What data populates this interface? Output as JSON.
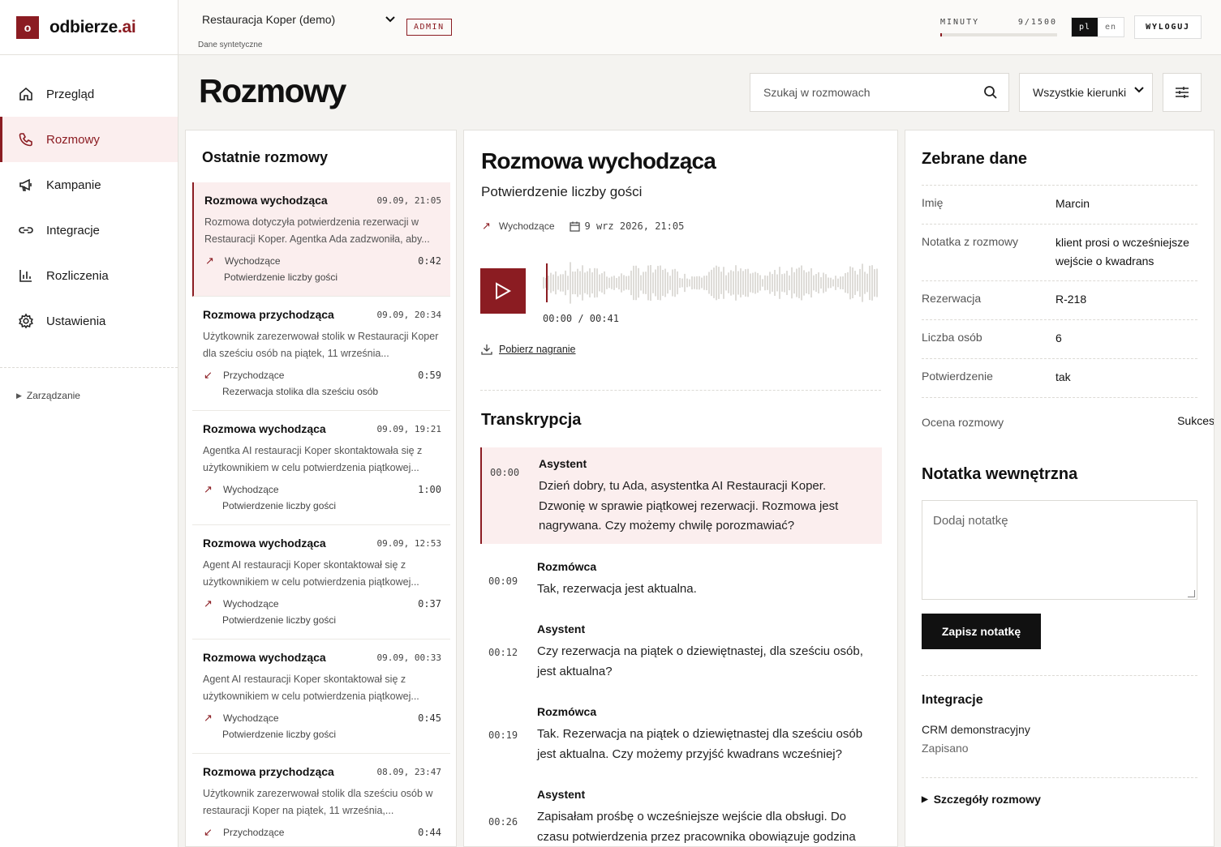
{
  "brand": {
    "logo_letter": "o",
    "name": "odbierze",
    "suffix": ".ai"
  },
  "nav": {
    "items": [
      {
        "label": "Przegląd",
        "icon": "home-icon"
      },
      {
        "label": "Rozmowy",
        "icon": "phone-icon"
      },
      {
        "label": "Kampanie",
        "icon": "megaphone-icon"
      },
      {
        "label": "Integracje",
        "icon": "link-icon"
      },
      {
        "label": "Rozliczenia",
        "icon": "bar-chart-icon"
      },
      {
        "label": "Ustawienia",
        "icon": "gear-icon"
      }
    ],
    "active_index": 1,
    "management_label": "Zarządzanie"
  },
  "topbar": {
    "restaurant": "Restauracja Koper (demo)",
    "restaurant_sub": "Dane syntetyczne",
    "admin_badge": "ADMIN",
    "minutes_label": "MINUTY",
    "minutes_value": "9/1500",
    "minutes_used": 9,
    "minutes_total": 1500,
    "lang_active": "pl",
    "lang_other": "en",
    "logout": "WYLOGUJ"
  },
  "page": {
    "title": "Rozmowy",
    "search_placeholder": "Szukaj w rozmowach",
    "direction_filter": "Wszystkie kierunki"
  },
  "list": {
    "title": "Ostatnie rozmowy",
    "calls": [
      {
        "title": "Rozmowa wychodząca",
        "date": "09.09, 21:05",
        "summary": "Rozmowa dotyczyła potwierdzenia rezerwacji w Restauracji Koper. Agentka Ada zadzwoniła, aby...",
        "direction": "Wychodzące",
        "arrow": "↗",
        "duration": "0:42",
        "topic": "Potwierdzenie liczby gości"
      },
      {
        "title": "Rozmowa przychodząca",
        "date": "09.09, 20:34",
        "summary": "Użytkownik zarezerwował stolik w Restauracji Koper dla sześciu osób na piątek, 11 września...",
        "direction": "Przychodzące",
        "arrow": "↙",
        "duration": "0:59",
        "topic": "Rezerwacja stolika dla sześciu osób"
      },
      {
        "title": "Rozmowa wychodząca",
        "date": "09.09, 19:21",
        "summary": "Agentka AI restauracji Koper skontaktowała się z użytkownikiem w celu potwierdzenia piątkowej...",
        "direction": "Wychodzące",
        "arrow": "↗",
        "duration": "1:00",
        "topic": "Potwierdzenie liczby gości"
      },
      {
        "title": "Rozmowa wychodząca",
        "date": "09.09, 12:53",
        "summary": "Agent AI restauracji Koper skontaktował się z użytkownikiem w celu potwierdzenia piątkowej...",
        "direction": "Wychodzące",
        "arrow": "↗",
        "duration": "0:37",
        "topic": "Potwierdzenie liczby gości"
      },
      {
        "title": "Rozmowa wychodząca",
        "date": "09.09, 00:33",
        "summary": "Agent AI restauracji Koper skontaktował się z użytkownikiem w celu potwierdzenia piątkowej...",
        "direction": "Wychodzące",
        "arrow": "↗",
        "duration": "0:45",
        "topic": "Potwierdzenie liczby gości"
      },
      {
        "title": "Rozmowa przychodząca",
        "date": "08.09, 23:47",
        "summary": "Użytkownik zarezerwował stolik dla sześciu osób w restauracji Koper na piątek, 11 września,...",
        "direction": "Przychodzące",
        "arrow": "↙",
        "duration": "0:44",
        "topic": ""
      }
    ]
  },
  "detail": {
    "title": "Rozmowa wychodząca",
    "subtitle": "Potwierdzenie liczby gości",
    "direction": "Wychodzące",
    "date": "9 wrz 2026, 21:05",
    "time": "00:00 / 00:41",
    "download": "Pobierz nagranie",
    "transcript_title": "Transkrypcja",
    "transcript": [
      {
        "ts": "00:00",
        "speaker": "Asystent",
        "text": "Dzień dobry, tu Ada, asystentka AI Restauracji Koper. Dzwonię w sprawie piątkowej rezerwacji. Rozmowa jest nagrywana. Czy możemy chwilę porozmawiać?"
      },
      {
        "ts": "00:09",
        "speaker": "Rozmówca",
        "text": "Tak, rezerwacja jest aktualna."
      },
      {
        "ts": "00:12",
        "speaker": "Asystent",
        "text": "Czy rezerwacja na piątek o dziewiętnastej, dla sześciu osób, jest aktualna?"
      },
      {
        "ts": "00:19",
        "speaker": "Rozmówca",
        "text": "Tak. Rezerwacja na piątek o dziewiętnastej dla sześciu osób jest aktualna. Czy możemy przyjść kwadrans wcześniej?"
      },
      {
        "ts": "00:26",
        "speaker": "Asystent",
        "text": "Zapisałam prośbę o wcześniejsze wejście dla obsługi. Do czasu potwierdzenia przez pracownika obowiązuje godzina"
      }
    ]
  },
  "collected": {
    "title": "Zebrane dane",
    "fields": [
      {
        "key": "Imię",
        "value": "Marcin"
      },
      {
        "key": "Notatka z rozmowy",
        "value": "klient prosi o wcześniejsze wejście o kwadrans"
      },
      {
        "key": "Rezerwacja",
        "value": "R-218"
      },
      {
        "key": "Liczba osób",
        "value": "6"
      },
      {
        "key": "Potwierdzenie",
        "value": "tak"
      },
      {
        "key": "Ocena rozmowy",
        "value": "Sukces"
      }
    ],
    "note_title": "Notatka wewnętrzna",
    "note_placeholder": "Dodaj notatkę",
    "save_label": "Zapisz notatkę",
    "integrations_title": "Integracje",
    "integration_name": "CRM demonstracyjny",
    "integration_status": "Zapisano",
    "details_label": "Szczegóły rozmowy"
  },
  "colors": {
    "accent": "#8b1c22",
    "accent_bg": "#fbeeee"
  }
}
